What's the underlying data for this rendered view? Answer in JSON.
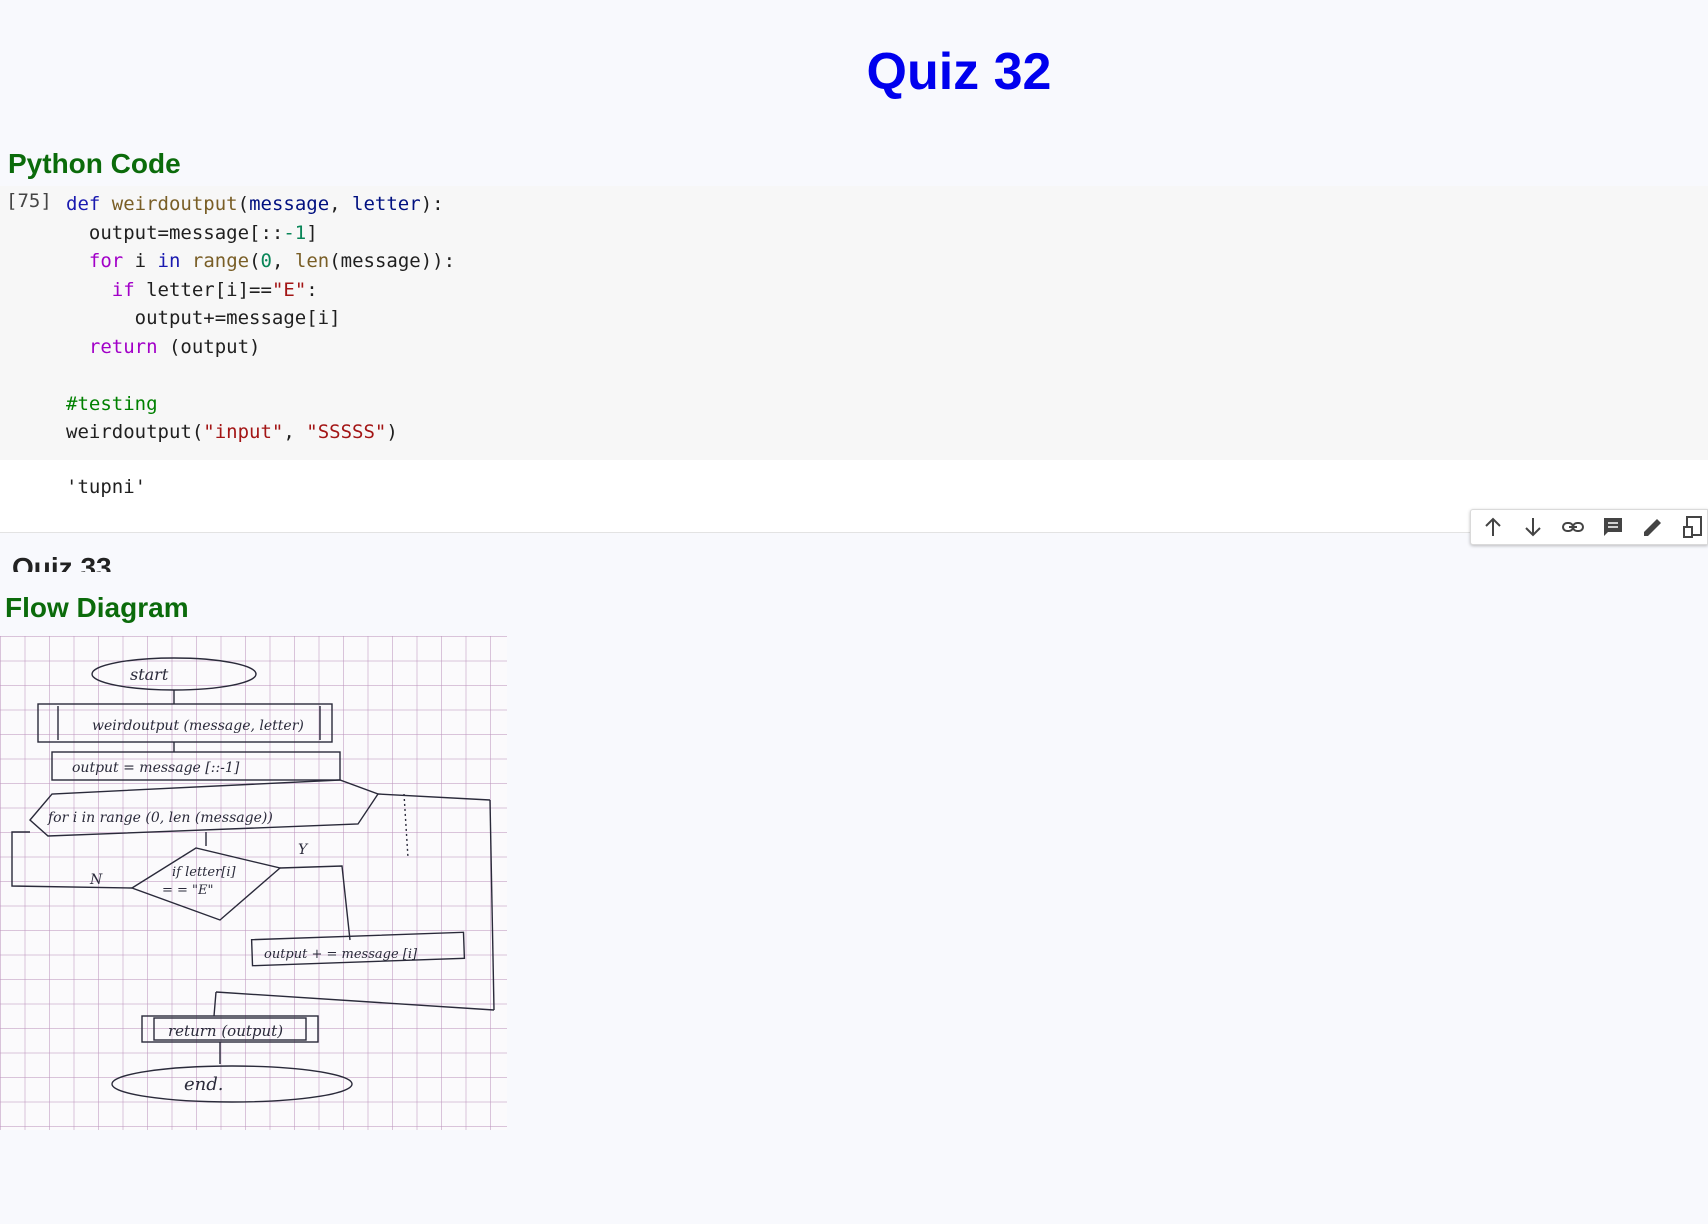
{
  "page": {
    "title": "Quiz 32"
  },
  "sections": {
    "code_heading": "Python Code",
    "flow_heading": "Flow Diagram"
  },
  "cell": {
    "execution_count": "[75]",
    "code_lines": [
      "def weirdoutput(message, letter):",
      "  output=message[::-1]",
      "  for i in range(0, len(message)):",
      "    if letter[i]==\"E\":",
      "      output+=message[i]",
      "  return (output)",
      "",
      "#testing",
      "weirdoutput(\"input\", \"SSSSS\")"
    ],
    "output": "'tupni'"
  },
  "toolbar": {
    "icons": [
      "arrow-up-icon",
      "arrow-down-icon",
      "link-icon",
      "comment-icon",
      "edit-icon",
      "mirror-cell-icon"
    ]
  },
  "diagram": {
    "labels": {
      "start": "start",
      "function": "weirdoutput (message, letter)",
      "assign": "output = message [::-1]",
      "loop": "for i in range (0, len (message))",
      "yes": "Y",
      "no": "N",
      "condition_line1": "if letter[i]",
      "condition_line2": "= = \"E\"",
      "append": "output + = message [i]",
      "return": "return (output)",
      "end": "end."
    }
  }
}
